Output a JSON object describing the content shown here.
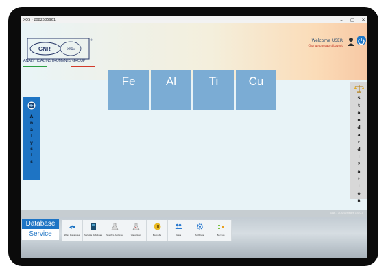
{
  "window": {
    "title": "XOS - 2082585961",
    "minimize_glyph": "–",
    "maximize_glyph": "▢",
    "close_glyph": "✕"
  },
  "brand": {
    "logo_text": "GNR",
    "group_name": "ANALYTICAL INSTRUMENTS GROUP"
  },
  "user": {
    "welcome": "Welcome USER",
    "change_action": "Change password Logout"
  },
  "elements": [
    {
      "symbol": "Fe"
    },
    {
      "symbol": "Al"
    },
    {
      "symbol": "Ti"
    },
    {
      "symbol": "Cu"
    }
  ],
  "side_tabs": {
    "analysis": [
      "A",
      "n",
      "a",
      "l",
      "y",
      "s",
      "i",
      "s"
    ],
    "standardization": [
      "S",
      "t",
      "a",
      "n",
      "d",
      "a",
      "r",
      "d",
      "i",
      "z",
      "a",
      "t",
      "i",
      "o",
      "n"
    ]
  },
  "status": {
    "text": "GNR - XOS Software 1.0.0.0"
  },
  "modes": {
    "database": "Database",
    "service": "Service"
  },
  "toolbar": [
    {
      "label": "Wiev Database",
      "icon": "back-arrow-icon"
    },
    {
      "label": "Sample database",
      "icon": "book-icon"
    },
    {
      "label": "Spectra Archive",
      "icon": "flask-icon"
    },
    {
      "label": "Visualizer",
      "icon": "chart-icon"
    },
    {
      "label": "Barcode",
      "icon": "barcode-icon"
    },
    {
      "label": "Users",
      "icon": "users-icon"
    },
    {
      "label": "Settings",
      "icon": "gear-icon"
    },
    {
      "label": "Backup",
      "icon": "tree-icon"
    }
  ],
  "colors": {
    "accent": "#1e74c4",
    "element_tile": "#7bacd4",
    "stripe_green": "#2ea043",
    "stripe_red": "#d23a2a"
  }
}
